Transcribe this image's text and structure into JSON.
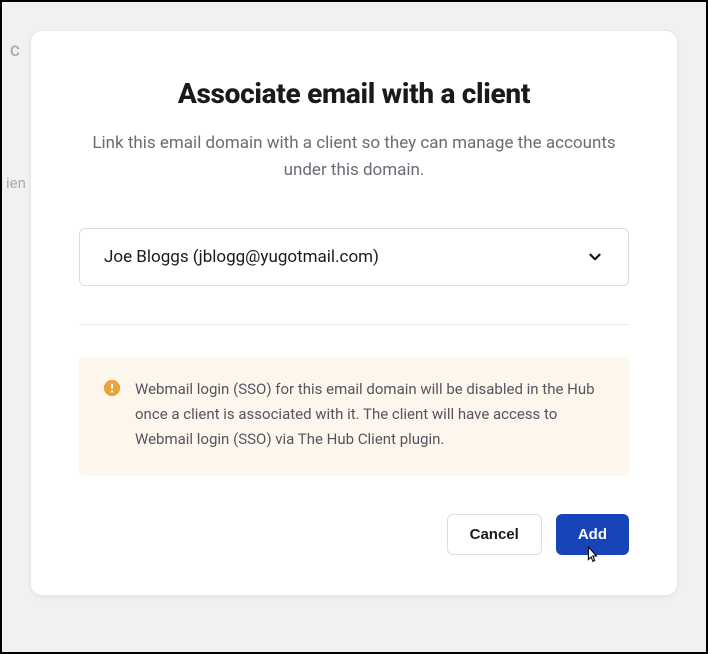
{
  "background": {
    "text1": "C",
    "text2": "ien"
  },
  "modal": {
    "title": "Associate email with a client",
    "subtitle": "Link this email domain with a client so they can manage the accounts under this domain.",
    "select": {
      "value": "Joe Bloggs (jblogg@yugotmail.com)"
    },
    "notice": {
      "text": "Webmail login (SSO) for this email domain will be disabled in the Hub once a client is associated with it. The client will have access to Webmail login (SSO) via The Hub Client plugin."
    },
    "buttons": {
      "cancel": "Cancel",
      "add": "Add"
    }
  }
}
